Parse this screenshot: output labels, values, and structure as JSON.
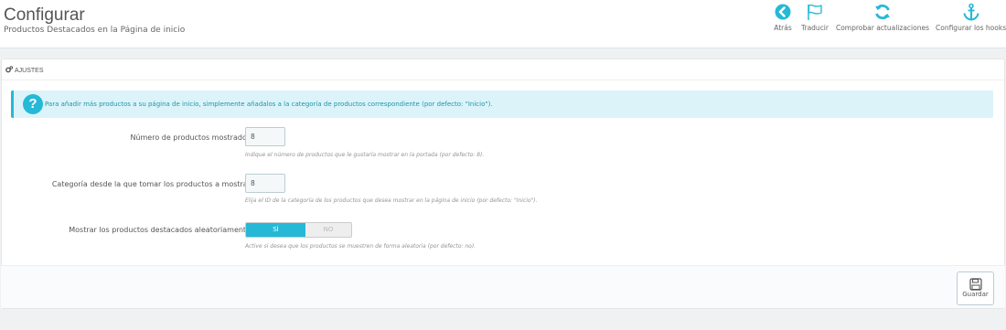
{
  "header": {
    "title": "Configurar",
    "subtitle": "Productos Destacados en la Página de inicio"
  },
  "toolbar": [
    {
      "label": "Atrás",
      "icon": "back-arrow-icon"
    },
    {
      "label": "Traducir",
      "icon": "flag-icon"
    },
    {
      "label": "Comprobar actualizaciones",
      "icon": "refresh-icon"
    },
    {
      "label": "Configurar los hooks",
      "icon": "anchor-icon"
    }
  ],
  "panel": {
    "heading": "AJUSTES",
    "info": "Para añadir más productos a su página de inicio, simplemente añadalos a la categoría de productos correspondiente (por defecto: \"Inicio\").",
    "fields": [
      {
        "label": "Número de productos mostrados",
        "value": "8",
        "help": "Indique el número de productos que le gustaría mostrar en la portada (por defecto: 8)."
      },
      {
        "label": "Categoría desde la que tomar los productos a mostrar",
        "value": "8",
        "help": "Elija el ID de la categoría de los productos que desea mostrar en la página de inicio (por defecto: \"Inicio\")."
      }
    ],
    "random": {
      "label": "Mostrar los productos destacados aleatoriamente",
      "yes": "SÍ",
      "no": "NO",
      "help": "Active si desea que los productos se muestren de forma aleatoria (por defecto: no)."
    },
    "save_label": "Guardar"
  },
  "colors": {
    "accent": "#25b9d7",
    "info_bg": "#dcf4f9",
    "info_text": "#1e94ab"
  }
}
